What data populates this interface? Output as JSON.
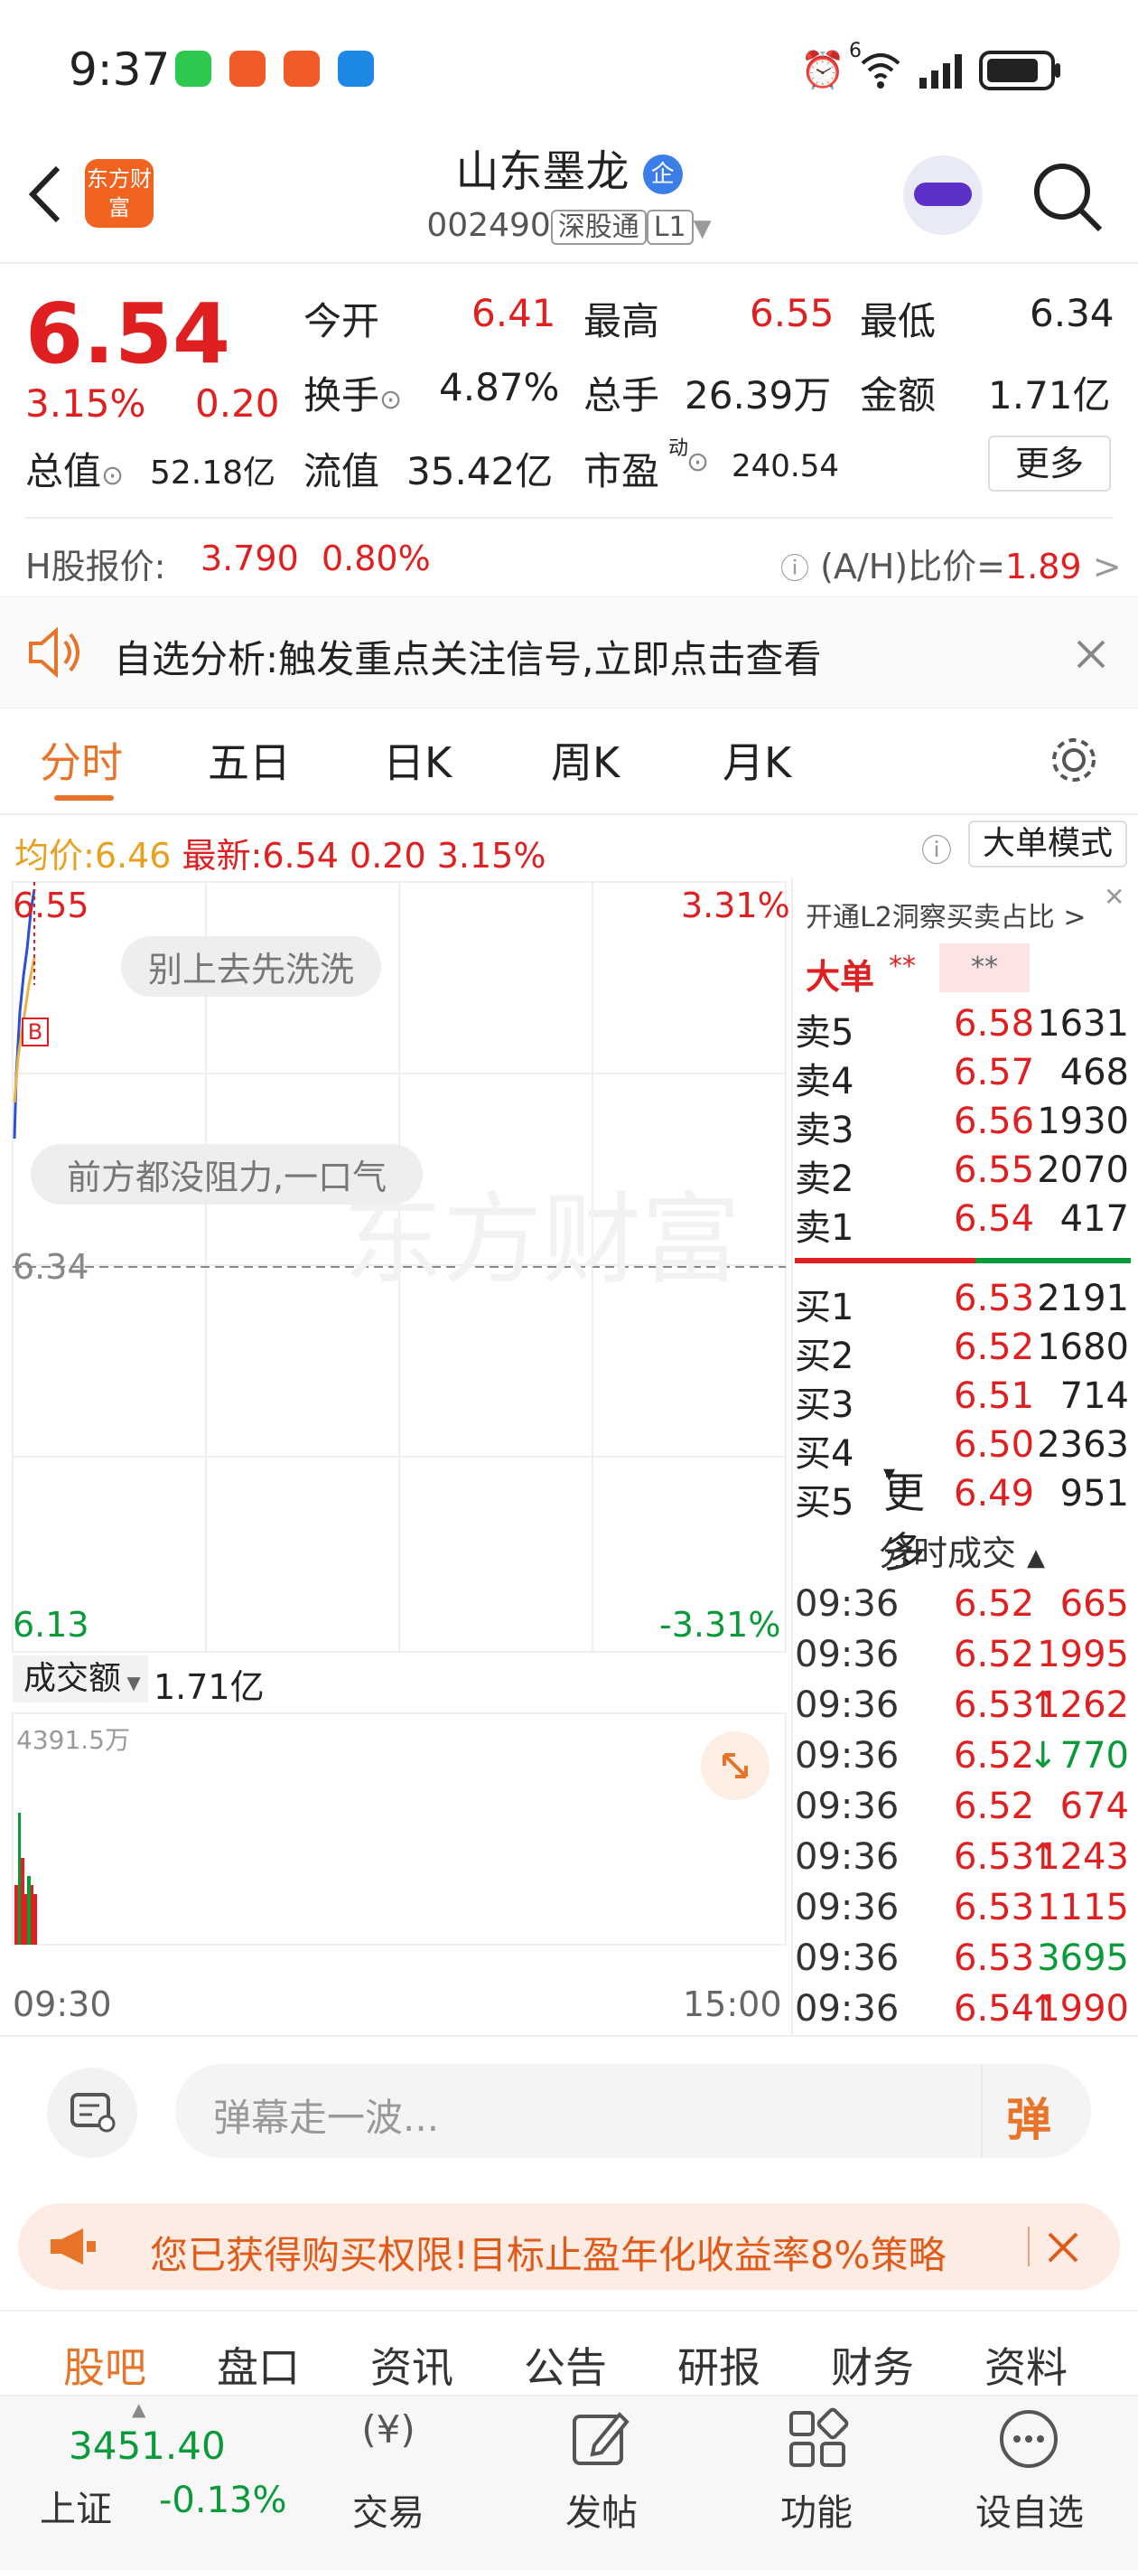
{
  "status": {
    "time": "9:37",
    "network": "6"
  },
  "header": {
    "title": "山东墨龙",
    "code": "002490",
    "market": "深股通",
    "level": "L1",
    "badge": "企",
    "logo_text": "东方财富"
  },
  "quote": {
    "price": "6.54",
    "pct": "3.15%",
    "chg": "0.20",
    "open_label": "今开",
    "open": "6.41",
    "high_label": "最高",
    "high": "6.55",
    "low_label": "最低",
    "low": "6.34",
    "turnover_label": "换手",
    "turnover": "4.87%",
    "vol_label": "总手",
    "vol": "26.39万",
    "amt_label": "金额",
    "amt": "1.71亿",
    "mcap_label": "总值",
    "mcap": "52.18亿",
    "float_label": "流值",
    "float": "35.42亿",
    "pe_label": "市盈",
    "pe_sup": "动",
    "pe": "240.54",
    "more": "更多"
  },
  "hshare": {
    "label": "H股报价:",
    "price": "3.790",
    "pct": "0.80%",
    "ah_label": "(A/H)比价=",
    "ah": "1.89"
  },
  "notice": {
    "text": "自选分析:触发重点关注信号,立即点击查看"
  },
  "tabs": [
    "分时",
    "五日",
    "日K",
    "周K",
    "月K",
    "更多"
  ],
  "chartinfo": {
    "avg_label": "均价:",
    "avg": "6.46",
    "last_label": "最新:",
    "last": "6.54",
    "chg": "0.20",
    "pct": "3.15%",
    "mode": "大单模式"
  },
  "chart": {
    "top_price": "6.55",
    "top_pct": "3.31%",
    "mid_price": "6.34",
    "bot_price": "6.13",
    "bot_pct": "-3.31%",
    "bubble1": "别上去先洗洗",
    "bubble2": "前方都没阻力,一口气",
    "watermark": "东方财富",
    "vol_label": "成交额",
    "vol_total": "1.71亿",
    "vol_max": "4391.5万",
    "t_start": "09:30",
    "t_end": "15:00",
    "marker": "B"
  },
  "orderbook": {
    "l2": "开通L2洞察买卖占比",
    "big": "大单",
    "mask1": "**",
    "mask2": "**",
    "asks": [
      {
        "l": "卖5",
        "p": "6.58",
        "v": "1631"
      },
      {
        "l": "卖4",
        "p": "6.57",
        "v": "468"
      },
      {
        "l": "卖3",
        "p": "6.56",
        "v": "1930"
      },
      {
        "l": "卖2",
        "p": "6.55",
        "v": "2070"
      },
      {
        "l": "卖1",
        "p": "6.54",
        "v": "417"
      }
    ],
    "bids": [
      {
        "l": "买1",
        "p": "6.53",
        "v": "2191"
      },
      {
        "l": "买2",
        "p": "6.52",
        "v": "1680"
      },
      {
        "l": "买3",
        "p": "6.51",
        "v": "714"
      },
      {
        "l": "买4",
        "p": "6.50",
        "v": "2363"
      },
      {
        "l": "买5",
        "p": "6.49",
        "v": "951"
      }
    ],
    "trades_title": "分时成交",
    "trades": [
      {
        "t": "09:36",
        "p": "6.52",
        "v": "665",
        "a": ""
      },
      {
        "t": "09:36",
        "p": "6.52",
        "v": "1995",
        "a": ""
      },
      {
        "t": "09:36",
        "p": "6.53",
        "v": "1262",
        "a": "↑"
      },
      {
        "t": "09:36",
        "p": "6.52",
        "v": "770",
        "a": "↓"
      },
      {
        "t": "09:36",
        "p": "6.52",
        "v": "674",
        "a": ""
      },
      {
        "t": "09:36",
        "p": "6.53",
        "v": "1243",
        "a": "↑"
      },
      {
        "t": "09:36",
        "p": "6.53",
        "v": "1115",
        "a": ""
      },
      {
        "t": "09:36",
        "p": "6.53",
        "v": "3695",
        "a": ""
      },
      {
        "t": "09:36",
        "p": "6.54",
        "v": "1990",
        "a": "↑"
      }
    ]
  },
  "danmu": {
    "placeholder": "弹幕走一波...",
    "btn": "弹"
  },
  "promo": {
    "text": "您已获得购买权限!目标止盈年化收益率8%策略"
  },
  "nav": [
    "股吧",
    "盘口",
    "资讯",
    "公告",
    "研报",
    "财务",
    "资料"
  ],
  "bottom": {
    "index_value": "3451.40",
    "index_name": "上证",
    "index_pct": "-0.13%",
    "trade": "交易",
    "post": "发帖",
    "func": "功能",
    "fav": "设自选"
  }
}
